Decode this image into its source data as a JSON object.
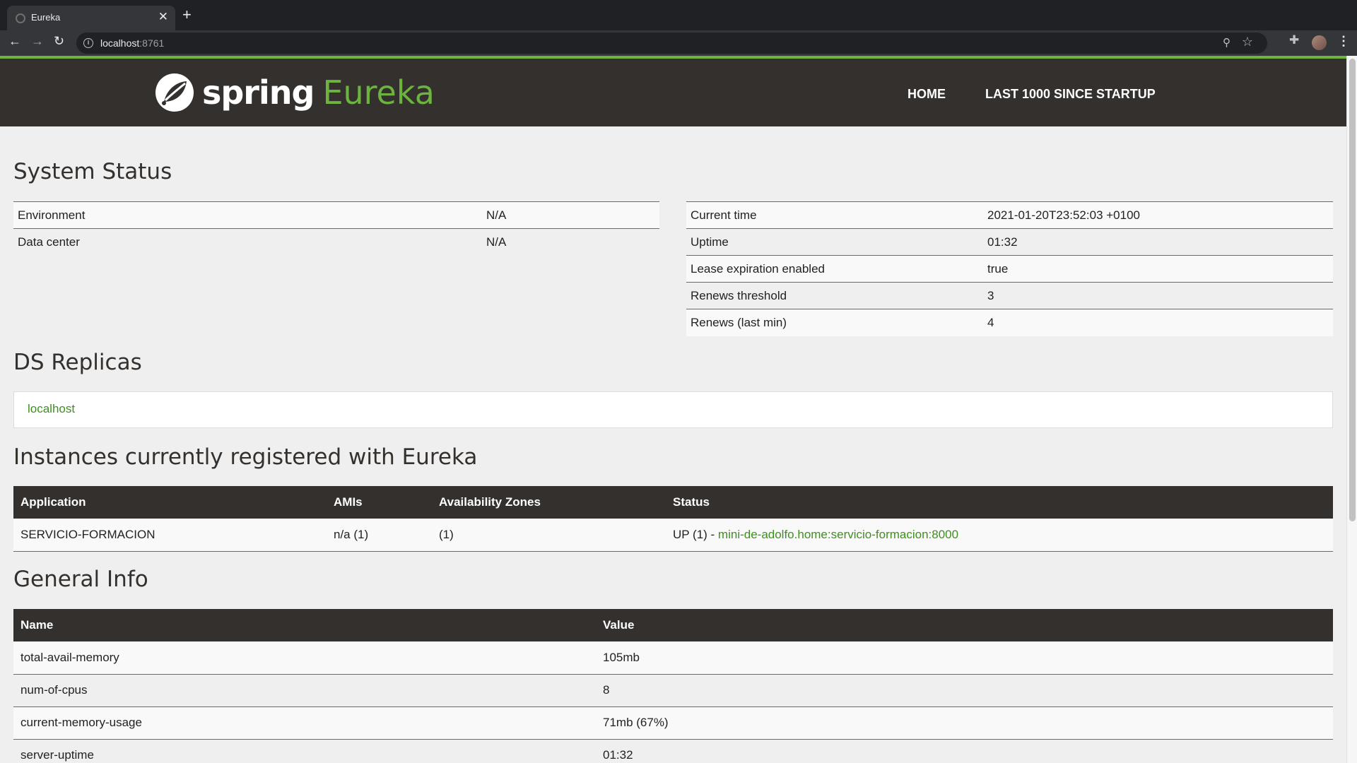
{
  "browser": {
    "tab_title": "Eureka",
    "url_host": "localhost",
    "url_port": ":8761"
  },
  "navbar": {
    "logo_spring": "spring",
    "logo_eureka": "Eureka",
    "home": "HOME",
    "last": "LAST 1000 SINCE STARTUP"
  },
  "system_status": {
    "title": "System Status",
    "left": [
      {
        "label": "Environment",
        "value": "N/A"
      },
      {
        "label": "Data center",
        "value": "N/A"
      }
    ],
    "right": [
      {
        "label": "Current time",
        "value": "2021-01-20T23:52:03 +0100"
      },
      {
        "label": "Uptime",
        "value": "01:32"
      },
      {
        "label": "Lease expiration enabled",
        "value": "true"
      },
      {
        "label": "Renews threshold",
        "value": "3"
      },
      {
        "label": "Renews (last min)",
        "value": "4"
      }
    ]
  },
  "replicas": {
    "title": "DS Replicas",
    "link": "localhost"
  },
  "instances": {
    "title": "Instances currently registered with Eureka",
    "headers": [
      "Application",
      "AMIs",
      "Availability Zones",
      "Status"
    ],
    "rows": [
      {
        "application": "SERVICIO-FORMACION",
        "amis": "n/a (1)",
        "zones": "(1)",
        "status": "UP (1) - ",
        "status_link": "mini-de-adolfo.home:servicio-formacion:8000"
      }
    ]
  },
  "general_info": {
    "title": "General Info",
    "headers": [
      "Name",
      "Value"
    ],
    "rows": [
      {
        "name": "total-avail-memory",
        "value": "105mb"
      },
      {
        "name": "num-of-cpus",
        "value": "8"
      },
      {
        "name": "current-memory-usage",
        "value": "71mb (67%)"
      },
      {
        "name": "server-uptime",
        "value": "01:32"
      }
    ]
  },
  "colors": {
    "brand_green": "#6db33f",
    "navbar_bg": "#34302d",
    "link_green": "#3f8f1f"
  }
}
